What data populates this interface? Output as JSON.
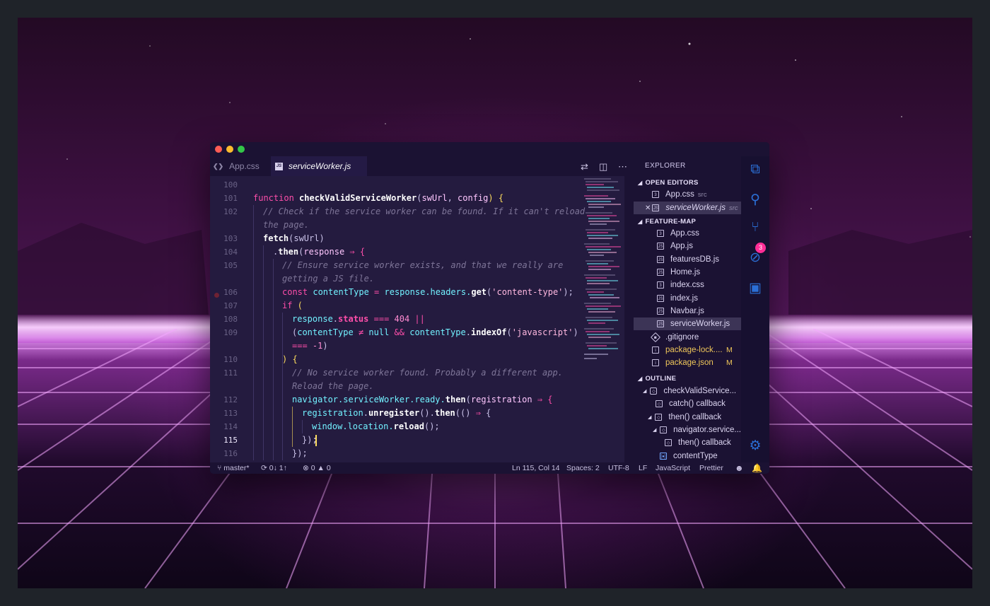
{
  "colors": {
    "editor_bg": "#241b3f",
    "window_bg": "#1b1233",
    "keyword": "#fe4eaa",
    "variable": "#72f1ff",
    "modified": "#f0c75a",
    "badge": "#ff2e97",
    "activity_icon": "#2b6fd6"
  },
  "tabs": [
    {
      "label": "App.css",
      "icon": "css3-icon"
    },
    {
      "label": "serviceWorker.js",
      "icon": "js-file-icon"
    }
  ],
  "toolbar": {
    "icons": [
      "open-changes-icon",
      "split-editor-icon",
      "more-actions-icon"
    ]
  },
  "code": {
    "lines": [
      "100",
      "101",
      "102",
      "",
      "103",
      "104",
      "105",
      "",
      "106",
      "107",
      "108",
      "109",
      "",
      "110",
      "111",
      "",
      "112",
      "113",
      "114",
      "115",
      "116"
    ],
    "current_line": "115",
    "tokens": {
      "l101": [
        "function",
        "checkValidServiceWorker",
        "(",
        "swUrl",
        ", ",
        "config",
        ") {"
      ],
      "l102a": "// Check if the service worker can be found. If it can't reload",
      "l102b": "the page.",
      "l103": [
        "fetch",
        "(swUrl)"
      ],
      "l104": [
        ".",
        "then",
        "(",
        "response",
        " ⇒ {"
      ],
      "l105a": "// Ensure service worker exists, and that we really are",
      "l105b": "getting a JS file.",
      "l106": [
        "const",
        " contentType ",
        "=",
        " response",
        ".headers.",
        "get",
        "(",
        "'content-type'",
        ");"
      ],
      "l107": [
        "if",
        " ("
      ],
      "l108": [
        "response",
        ".",
        "status",
        " === ",
        "404",
        " ||"
      ],
      "l109": [
        "(",
        "contentType",
        " ≠ ",
        "null",
        " && ",
        "contentType",
        ".",
        "indexOf",
        "(",
        "'javascript'",
        ")"
      ],
      "l109b": [
        "===",
        " -1",
        ")"
      ],
      "l110": [
        ") {"
      ],
      "l111a": "// No service worker found. Probably a different app.",
      "l111b": "Reload the page.",
      "l112": [
        "navigator",
        ".serviceWorker.ready.",
        "then",
        "(",
        "registration",
        " ⇒ {"
      ],
      "l113": [
        "registration",
        ".",
        "unregister",
        "().",
        "then",
        "(() ",
        "⇒",
        " {"
      ],
      "l114": [
        "window",
        ".location.",
        "reload",
        "();"
      ],
      "l115": [
        "});"
      ],
      "l116": [
        "});"
      ]
    }
  },
  "sidebar": {
    "title": "EXPLORER",
    "open_editors_label": "OPEN EDITORS",
    "open_editors": [
      {
        "name": "App.css",
        "desc": "src",
        "icon": "css3-icon"
      },
      {
        "name": "serviceWorker.js",
        "desc": "src",
        "icon": "js-file-icon",
        "close": "✕"
      }
    ],
    "folder_label": "FEATURE-MAP",
    "files": [
      {
        "name": "App.css",
        "icon": "css3-icon"
      },
      {
        "name": "App.js",
        "icon": "js-file-icon"
      },
      {
        "name": "featuresDB.js",
        "icon": "js-file-icon"
      },
      {
        "name": "Home.js",
        "icon": "js-file-icon"
      },
      {
        "name": "index.css",
        "icon": "css3-icon"
      },
      {
        "name": "index.js",
        "icon": "js-file-icon"
      },
      {
        "name": "Navbar.js",
        "icon": "js-file-icon"
      },
      {
        "name": "serviceWorker.js",
        "icon": "js-file-icon"
      },
      {
        "name": ".gitignore",
        "icon": "git-icon"
      },
      {
        "name": "package-lock....",
        "icon": "json-file-icon",
        "flag": "M"
      },
      {
        "name": "package.json",
        "icon": "json-file-icon",
        "flag": "M"
      }
    ],
    "outline_label": "OUTLINE",
    "outline": [
      {
        "name": "checkValidService..."
      },
      {
        "name": "catch() callback"
      },
      {
        "name": "then() callback"
      },
      {
        "name": "navigator.service..."
      },
      {
        "name": "then() callback"
      },
      {
        "name": "contentType"
      }
    ]
  },
  "activity": {
    "icons": [
      "files-icon",
      "search-icon",
      "source-control-icon",
      "debug-icon",
      "extensions-icon",
      "settings-gear-icon"
    ],
    "badge": "3"
  },
  "status": {
    "branch": "master*",
    "sync": "0↓ 1↑",
    "errors": "0",
    "warnings": "0",
    "position": "Ln 115, Col 14",
    "spaces": "Spaces: 2",
    "encoding": "UTF-8",
    "eol": "LF",
    "language": "JavaScript",
    "formatter": "Prettier"
  }
}
